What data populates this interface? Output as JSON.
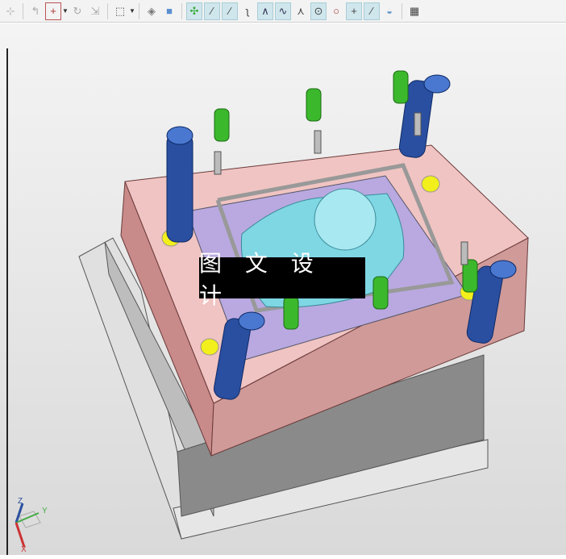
{
  "toolbar": {
    "groups": [
      [
        "snap-icon"
      ],
      [
        "move-handle-icon",
        "point-constructor-icon",
        "rotate-icon",
        "transform-icon"
      ],
      [
        "selection-box-icon"
      ],
      [
        "shaded-solid-icon",
        "cube-icon"
      ],
      [
        "snap-points-icon",
        "end-point-icon",
        "mid-point-icon",
        "curve-icon",
        "control-point-icon",
        "spline-icon",
        "intersection-icon",
        "arc-center-icon",
        "quadrant-icon",
        "point-on-curve-icon",
        "tangent-icon",
        "point-on-face-icon"
      ],
      [
        "grid-icon"
      ]
    ]
  },
  "banner": {
    "text": "图 文 设 计"
  },
  "triad": {
    "x": "X",
    "y": "Y",
    "z": "Z"
  },
  "colors": {
    "plate": "#e8b8b8",
    "insert": "#b9a9e0",
    "column": "#2a4fa0",
    "bolt": "#3cb82c",
    "part": "#7fd7e4",
    "marker": "#f2ef1c"
  }
}
